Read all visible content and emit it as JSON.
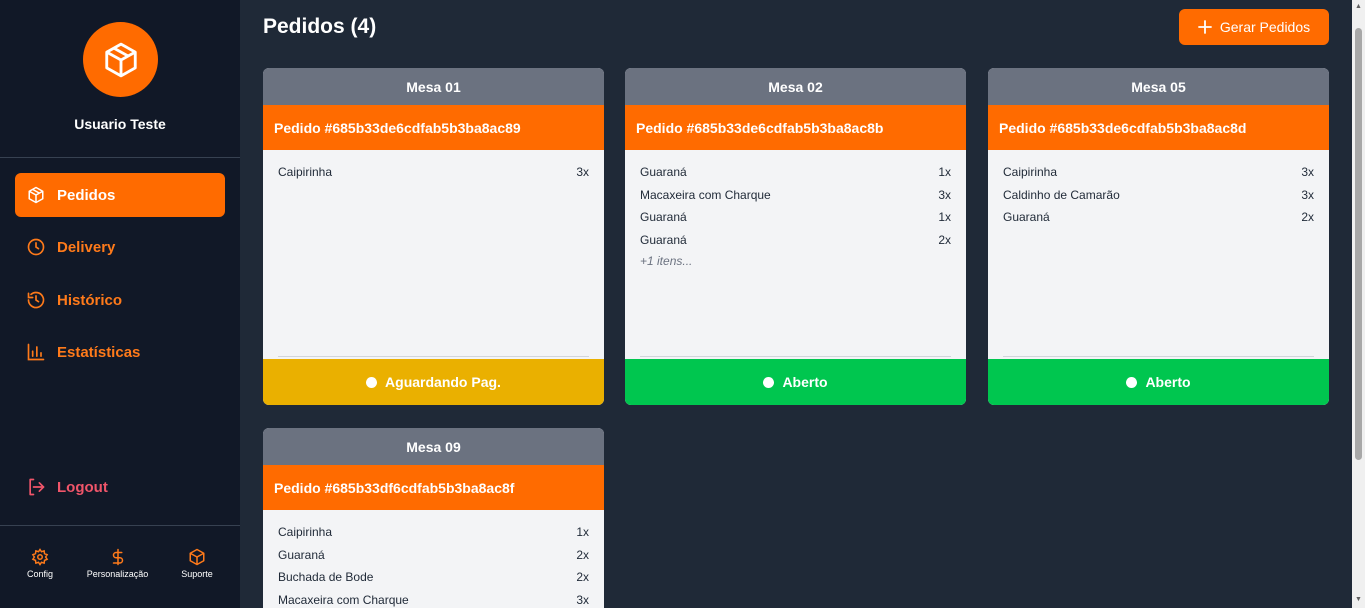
{
  "sidebar": {
    "user_name": "Usuario Teste",
    "nav": [
      {
        "label": "Pedidos",
        "icon": "box-icon",
        "active": true
      },
      {
        "label": "Delivery",
        "icon": "clock-icon"
      },
      {
        "label": "Histórico",
        "icon": "history-icon"
      },
      {
        "label": "Estatísticas",
        "icon": "bar-chart-icon"
      }
    ],
    "logout_label": "Logout",
    "bottom": [
      {
        "label": "Config",
        "icon": "gear-icon"
      },
      {
        "label": "Personalização",
        "icon": "dollar-icon"
      },
      {
        "label": "Suporte",
        "icon": "box-icon"
      }
    ]
  },
  "main": {
    "title": "Pedidos (4)",
    "generate_button": "Gerar Pedidos"
  },
  "orders": [
    {
      "table": "Mesa 01",
      "order_id": "Pedido #685b33de6cdfab5b3ba8ac89",
      "items": [
        {
          "name": "Caipirinha",
          "qty": "3x"
        }
      ],
      "more": "",
      "status": "Aguardando Pag."
    },
    {
      "table": "Mesa 02",
      "order_id": "Pedido #685b33de6cdfab5b3ba8ac8b",
      "items": [
        {
          "name": "Guaraná",
          "qty": "1x"
        },
        {
          "name": "Macaxeira com Charque",
          "qty": "3x"
        },
        {
          "name": "Guaraná",
          "qty": "1x"
        },
        {
          "name": "Guaraná",
          "qty": "2x"
        }
      ],
      "more": "+1 itens...",
      "status": "Aberto"
    },
    {
      "table": "Mesa 05",
      "order_id": "Pedido #685b33de6cdfab5b3ba8ac8d",
      "items": [
        {
          "name": "Caipirinha",
          "qty": "3x"
        },
        {
          "name": "Caldinho de Camarão",
          "qty": "3x"
        },
        {
          "name": "Guaraná",
          "qty": "2x"
        }
      ],
      "more": "",
      "status": "Aberto"
    },
    {
      "table": "Mesa 09",
      "order_id": "Pedido #685b33df6cdfab5b3ba8ac8f",
      "items": [
        {
          "name": "Caipirinha",
          "qty": "1x"
        },
        {
          "name": "Guaraná",
          "qty": "2x"
        },
        {
          "name": "Buchada de Bode",
          "qty": "2x"
        },
        {
          "name": "Macaxeira com Charque",
          "qty": "3x"
        }
      ],
      "more": "",
      "status": ""
    }
  ],
  "colors": {
    "accent": "#ff6b00",
    "status_waiting": "#eab000",
    "status_open": "#00c64f"
  }
}
